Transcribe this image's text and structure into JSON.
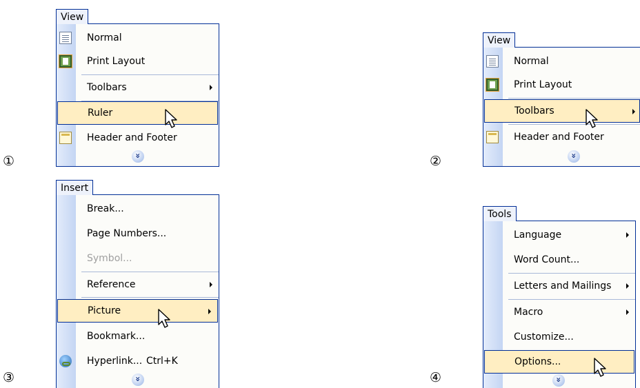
{
  "panels": [
    {
      "number": "①",
      "menu_title": "View",
      "items": [
        {
          "label": "Normal",
          "icon": "normal-view-icon"
        },
        {
          "label": "Print Layout",
          "icon": "print-layout-icon"
        },
        {
          "label": "Toolbars",
          "submenu": true
        },
        {
          "label": "Ruler",
          "highlighted": true
        },
        {
          "label": "Header and Footer",
          "icon": "header-footer-icon"
        }
      ]
    },
    {
      "number": "②",
      "menu_title": "View",
      "items": [
        {
          "label": "Normal",
          "icon": "normal-view-icon"
        },
        {
          "label": "Print Layout",
          "icon": "print-layout-icon"
        },
        {
          "label": "Toolbars",
          "submenu": true,
          "highlighted": true
        },
        {
          "label": "Header and Footer",
          "icon": "header-footer-icon"
        }
      ]
    },
    {
      "number": "③",
      "menu_title": "Insert",
      "items": [
        {
          "label": "Break..."
        },
        {
          "label": "Page Numbers..."
        },
        {
          "label": "Symbol...",
          "disabled": true
        },
        {
          "label": "Reference",
          "submenu": true
        },
        {
          "label": "Picture",
          "submenu": true,
          "highlighted": true
        },
        {
          "label": "Bookmark..."
        },
        {
          "label": "Hyperlink...",
          "shortcut": "Ctrl+K",
          "icon": "hyperlink-icon"
        }
      ]
    },
    {
      "number": "④",
      "menu_title": "Tools",
      "items": [
        {
          "label": "Language",
          "submenu": true
        },
        {
          "label": "Word Count..."
        },
        {
          "label": "Letters and Mailings",
          "submenu": true
        },
        {
          "label": "Macro",
          "submenu": true
        },
        {
          "label": "Customize..."
        },
        {
          "label": "Options...",
          "highlighted": true
        }
      ]
    }
  ]
}
